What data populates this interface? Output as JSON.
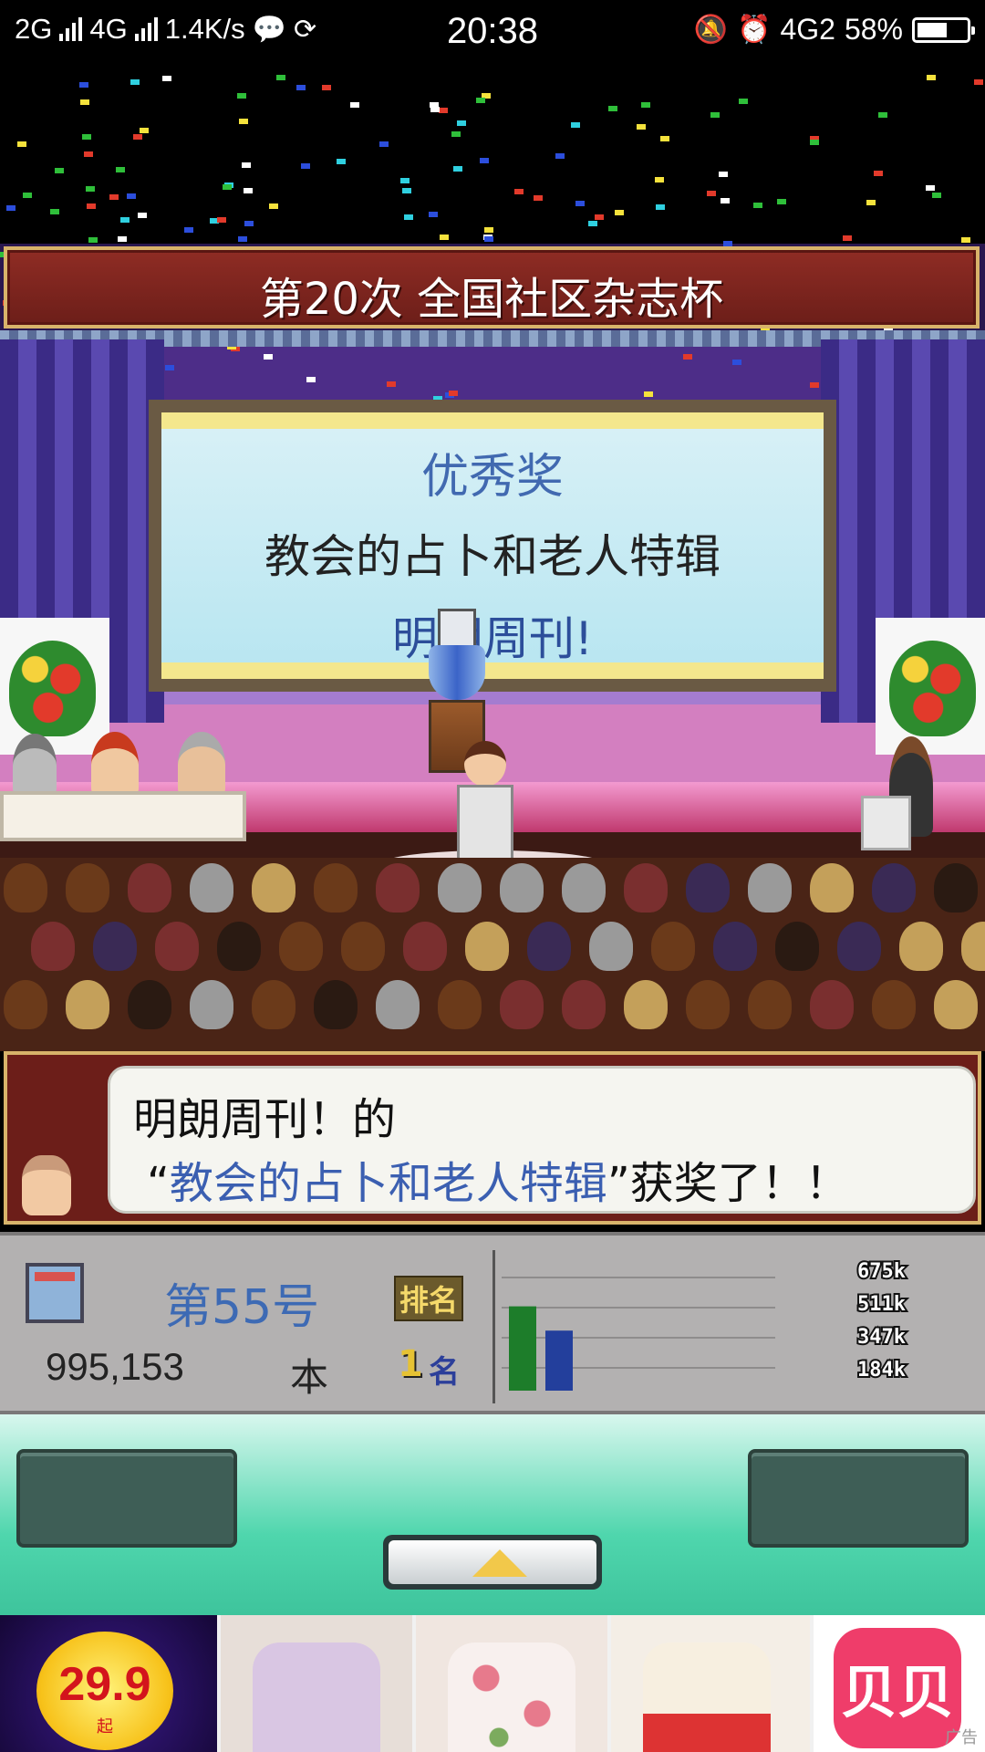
{
  "status_bar": {
    "network1": "2G",
    "network2": "4G",
    "speed": "1.4K/s",
    "time": "20:38",
    "network3": "4G2",
    "battery": "58%"
  },
  "game": {
    "contest_title": "第20次 全国社区杂志杯",
    "screen": {
      "award": "优秀奖",
      "feature": "教会的占卜和老人特辑",
      "magazine": "明朗周刊!"
    },
    "dialog": {
      "line1": "明朗周刊！的",
      "quote_open": "“",
      "feature": "教会的占卜和老人特辑",
      "quote_close": "”",
      "line2_suffix": "获奖了！！"
    },
    "stats": {
      "issue": "第55号",
      "sales": "995,153",
      "sales_unit": "本",
      "rank_label": "排名",
      "rank_value": "1",
      "rank_unit": "名"
    }
  },
  "chart_data": {
    "type": "bar",
    "series": [
      {
        "values": [
          0.66
        ]
      },
      {
        "values": [
          0.47
        ]
      }
    ],
    "colors": [
      "#1d7d2a",
      "#233f9c"
    ],
    "tick_labels": [
      "675k",
      "511k",
      "347k",
      "184k"
    ]
  },
  "controls": {
    "up_icon": "up-arrow-icon"
  },
  "ad": {
    "price": "29.9",
    "price_suffix": "起",
    "brand": "贝贝",
    "tag": "广告"
  }
}
